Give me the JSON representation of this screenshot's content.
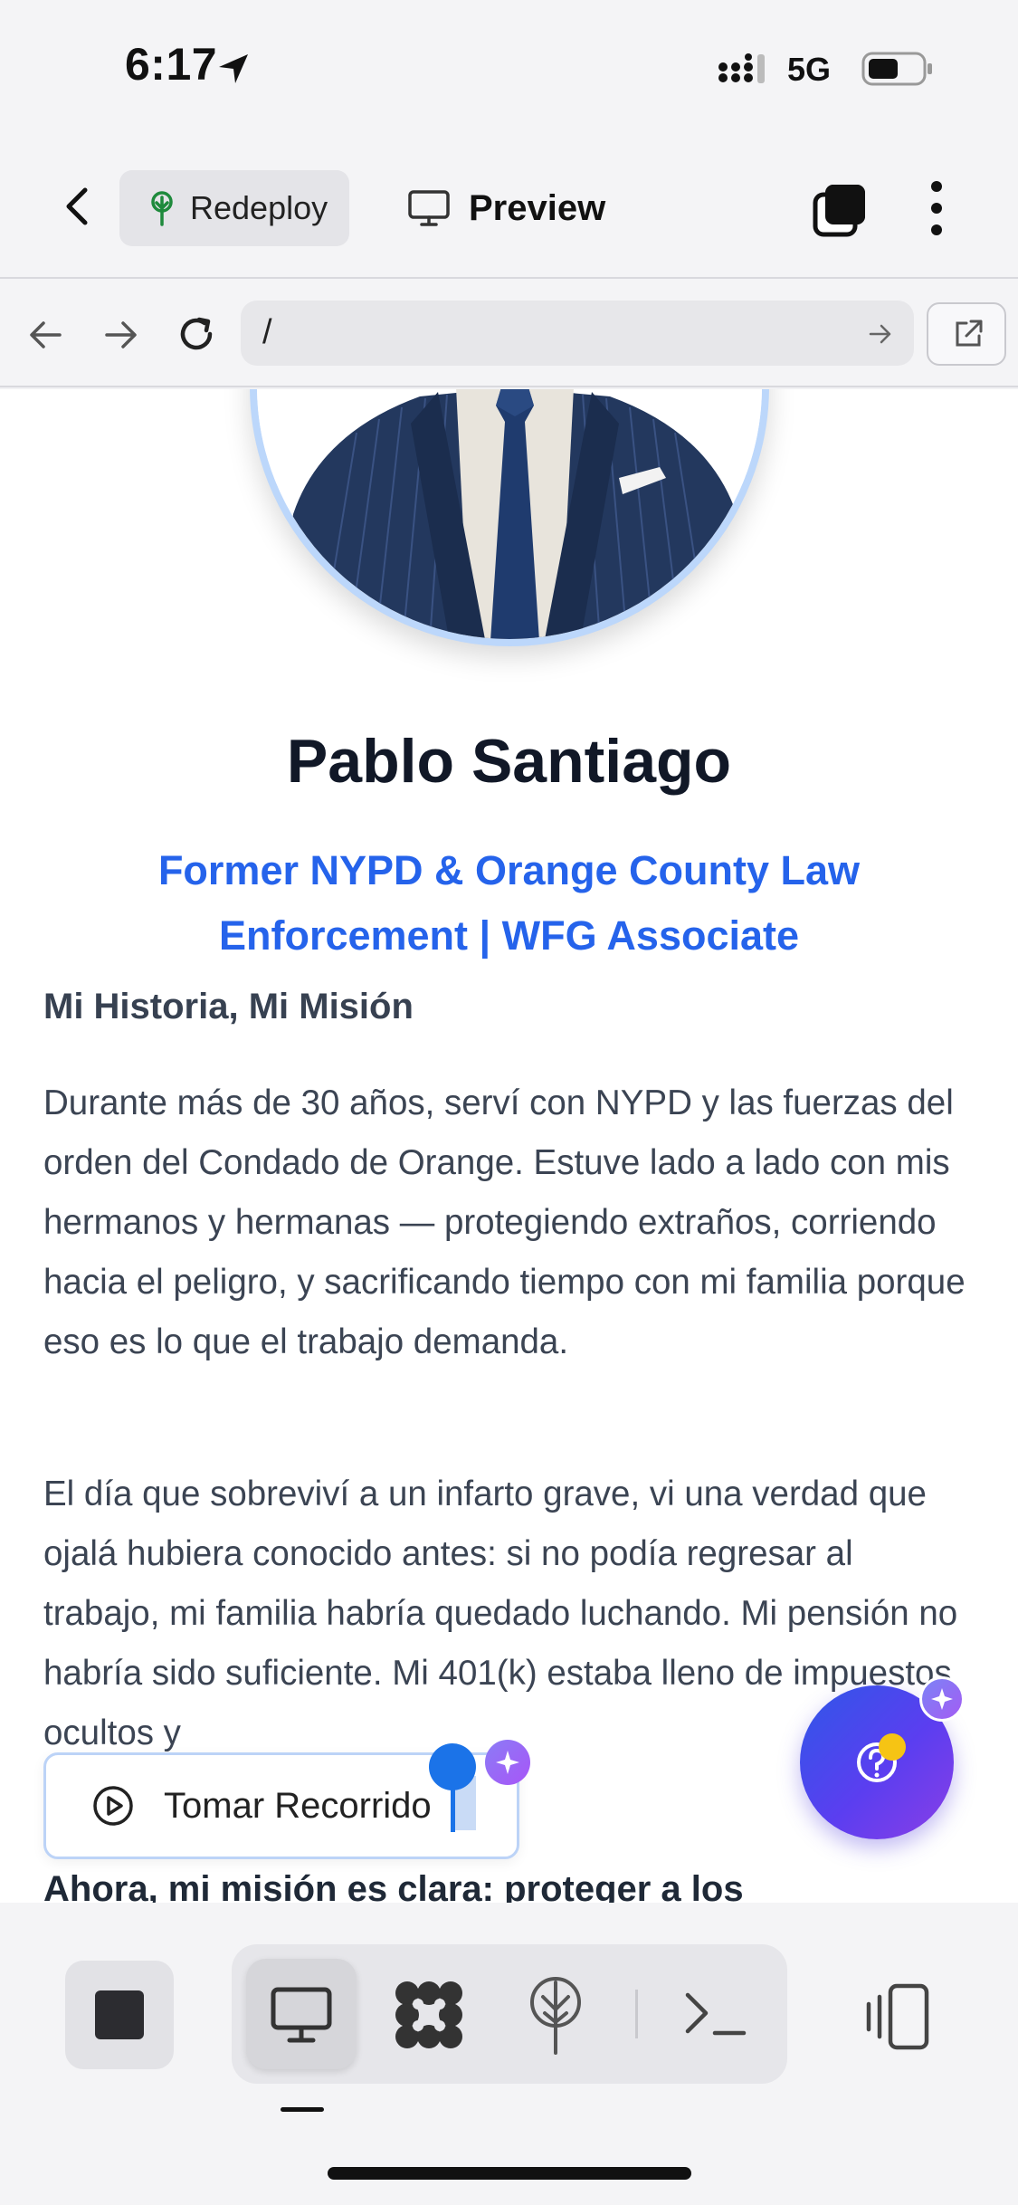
{
  "status_bar": {
    "time": "6:17",
    "network": "5G"
  },
  "app_bar": {
    "redeploy_label": "Redeploy",
    "preview_label": "Preview"
  },
  "url_bar": {
    "url": "/"
  },
  "profile": {
    "name": "Pablo Santiago",
    "subtitle": "Former NYPD & Orange County Law Enforcement | WFG Associate",
    "section_heading": "Mi Historia, Mi Misión",
    "paragraphs": [
      "Durante más de 30 años, serví con NYPD y las fuerzas del orden del Condado de Orange. Estuve lado a lado con mis hermanos y hermanas — protegiendo extraños, corriendo hacia el peligro, y sacrificando tiempo con mi familia porque eso es lo que el trabajo demanda.",
      "El día que sobreviví a un infarto grave, vi una verdad que ojalá hubiera conocido antes: si no podía regresar al trabajo, mi familia habría quedado luchando. Mi pensión no habría sido suficiente. Mi 401(k) estaba lleno de impuestos ocultos y",
      "Ahora, mi misión es clara: proteger a los"
    ]
  },
  "overlay": {
    "tour_label": "Tomar Recorrido"
  },
  "colors": {
    "accent": "#2563eb",
    "fab_start": "#2f57e8",
    "fab_end": "#8a3fe6"
  },
  "icons": [
    "location-arrow-icon",
    "signal-icon",
    "battery-icon",
    "back-chevron-icon",
    "deploy-tree-icon",
    "monitor-icon",
    "tabs-icon",
    "more-vert-icon",
    "arrow-left-icon",
    "arrow-right-icon",
    "reload-icon",
    "arrow-go-icon",
    "external-link-icon",
    "play-circle-icon",
    "sparkle-icon",
    "help-icon",
    "stop-icon",
    "desktop-icon",
    "apps-icon",
    "deploy-icon",
    "terminal-icon",
    "devices-icon"
  ]
}
